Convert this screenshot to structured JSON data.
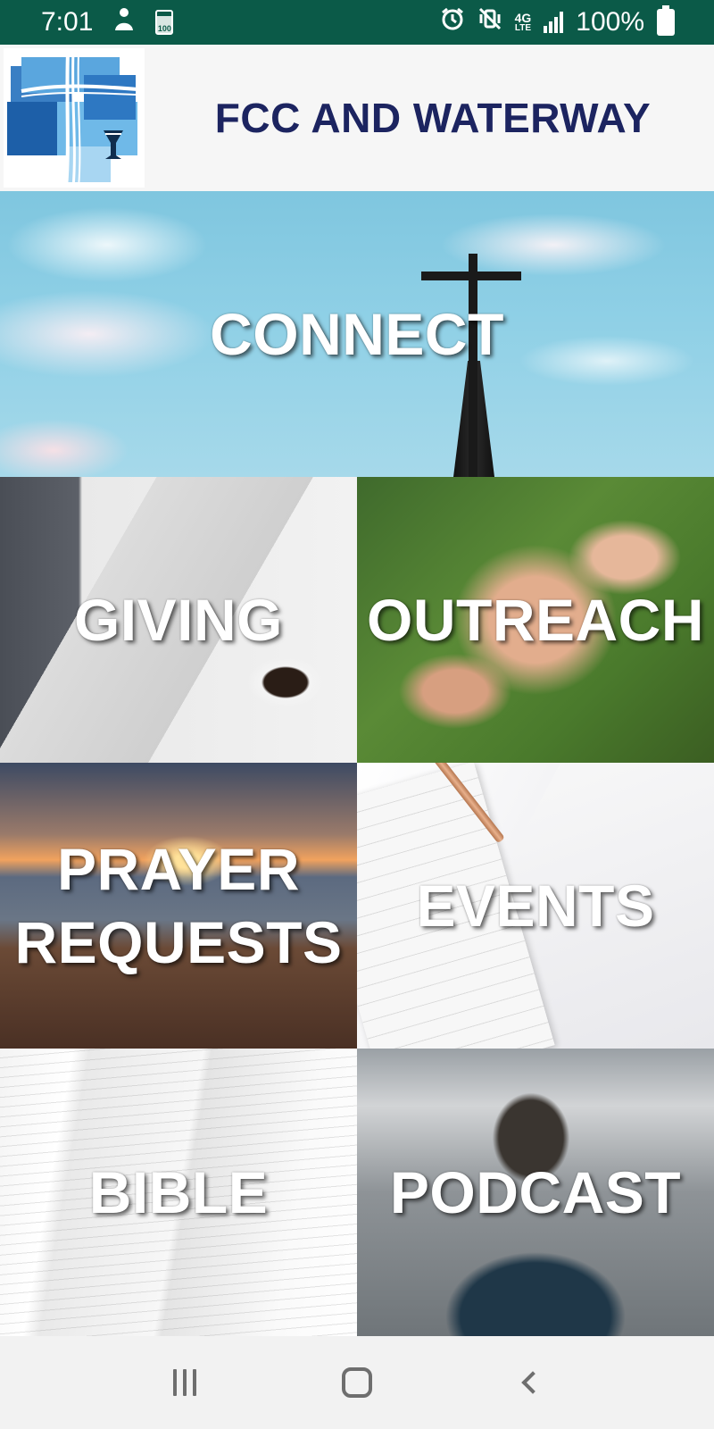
{
  "status_bar": {
    "time": "7:01",
    "battery_percent": "100%",
    "small_battery_label": "100",
    "network_label": "4G",
    "network_sub_label": "LTE",
    "icons": [
      "person-icon",
      "battery-saver-icon",
      "alarm-icon",
      "vibrate-mute-icon",
      "lte-icon",
      "signal-icon",
      "battery-icon"
    ]
  },
  "header": {
    "title": "FCC AND WATERWAY"
  },
  "tiles": {
    "connect": "CONNECT",
    "giving": "GIVING",
    "outreach": "OUTREACH",
    "prayer_line1": "PRAYER",
    "prayer_line2": "REQUESTS",
    "events": "EVENTS",
    "bible": "BIBLE",
    "podcast": "PODCAST"
  },
  "nav_bar": {
    "buttons": [
      "recents-icon",
      "home-icon",
      "back-icon"
    ]
  },
  "colors": {
    "status_bar_bg": "#0b5a48",
    "header_title": "#1c2460",
    "header_bg": "#f6f6f6",
    "nav_bar_bg": "#f2f2f2"
  }
}
